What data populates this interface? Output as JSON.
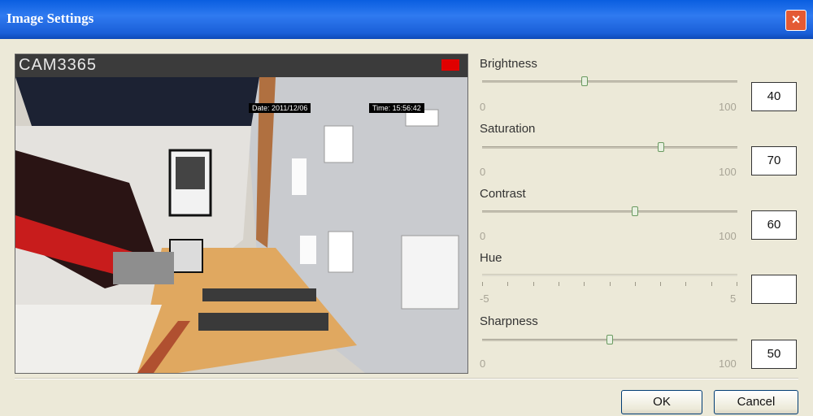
{
  "window": {
    "title": "Image Settings"
  },
  "preview": {
    "camera_name": "CAM3365",
    "osd_date": "Date: 2011/12/06",
    "osd_time": "Time: 15:56:42"
  },
  "sliders": [
    {
      "label": "Brightness",
      "min": "0",
      "max": "100",
      "value": "40",
      "level": 0.4
    },
    {
      "label": "Saturation",
      "min": "0",
      "max": "100",
      "value": "70",
      "level": 0.7
    },
    {
      "label": "Contrast",
      "min": "0",
      "max": "100",
      "value": "60",
      "level": 0.6
    },
    {
      "label": "Hue",
      "min": "-5",
      "max": "5",
      "value": "",
      "level": 0.5
    },
    {
      "label": "Sharpness",
      "min": "0",
      "max": "100",
      "value": "50",
      "level": 0.5
    }
  ],
  "buttons": {
    "ok": "OK",
    "cancel": "Cancel"
  },
  "colors": {
    "titlebar": "#2f7af0",
    "close": "#e45a34",
    "record": "#e00000",
    "background": "#ece9d8"
  }
}
